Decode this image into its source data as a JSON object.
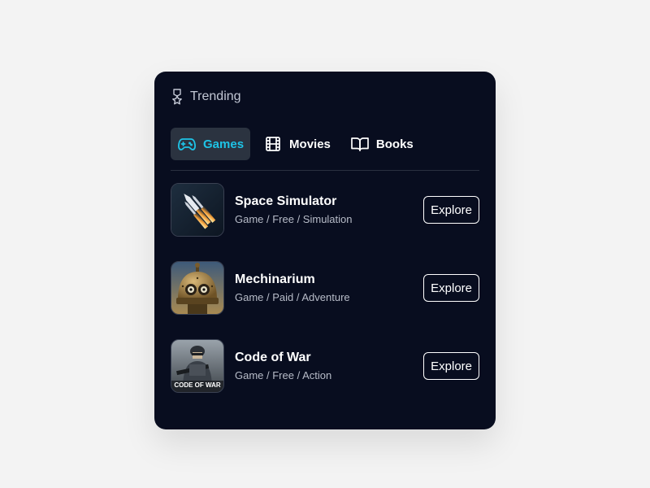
{
  "header": {
    "icon": "award-ribbon-icon",
    "title": "Trending"
  },
  "tabs": [
    {
      "label": "Games",
      "icon": "gamepad-icon",
      "active": true
    },
    {
      "label": "Movies",
      "icon": "film-icon",
      "active": false
    },
    {
      "label": "Books",
      "icon": "book-icon",
      "active": false
    }
  ],
  "items": [
    {
      "title": "Space Simulator",
      "subtitle": "Game / Free / Simulation",
      "button": "Explore",
      "thumb": "rocket-launch-thumbnail"
    },
    {
      "title": "Mechinarium",
      "subtitle": "Game / Paid / Adventure",
      "button": "Explore",
      "thumb": "robot-head-thumbnail"
    },
    {
      "title": "Code of War",
      "subtitle": "Game / Free / Action",
      "button": "Explore",
      "thumb": "soldier-thumbnail",
      "thumb_text": "CODE OF WAR"
    }
  ],
  "colors": {
    "card_bg": "#080d1f",
    "accent": "#1ec3e6",
    "active_tab_bg": "#2b3340",
    "page_bg": "#f3f3f3"
  }
}
